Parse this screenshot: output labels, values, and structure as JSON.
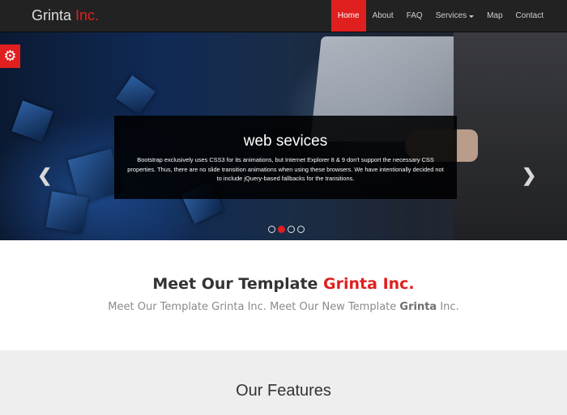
{
  "navbar": {
    "brand_main": "Grinta",
    "brand_accent": "Inc.",
    "items": [
      {
        "label": "Home",
        "active": true
      },
      {
        "label": "About"
      },
      {
        "label": "FAQ"
      },
      {
        "label": "Services",
        "dropdown": true
      },
      {
        "label": "Map"
      },
      {
        "label": "Contact"
      }
    ]
  },
  "hero": {
    "settings_icon": "gear-icon",
    "prev_icon": "chevron-left-icon",
    "next_icon": "chevron-right-icon",
    "caption_title": "web sevices",
    "caption_text": "Bootstrap exclusively uses CSS3 for its animations, but Internet Explorer 8 & 9 don't support the necessary CSS properties. Thus, there are no slide transition animations when using these browsers. We have intentionally decided not to include jQuery-based fallbacks for the transitions.",
    "slides_total": 4,
    "active_slide": 2
  },
  "intro": {
    "title_main": "Meet Our Template",
    "title_accent": "Grinta Inc.",
    "sub_part1": "Meet Our Template Grinta Inc. Meet Our New Template",
    "sub_bold": "Grinta",
    "sub_part2": "Inc."
  },
  "features": {
    "title": "Our Features"
  },
  "colors": {
    "accent": "#e01f1f",
    "navbar_bg": "#222222",
    "features_bg": "#eeeeee"
  }
}
